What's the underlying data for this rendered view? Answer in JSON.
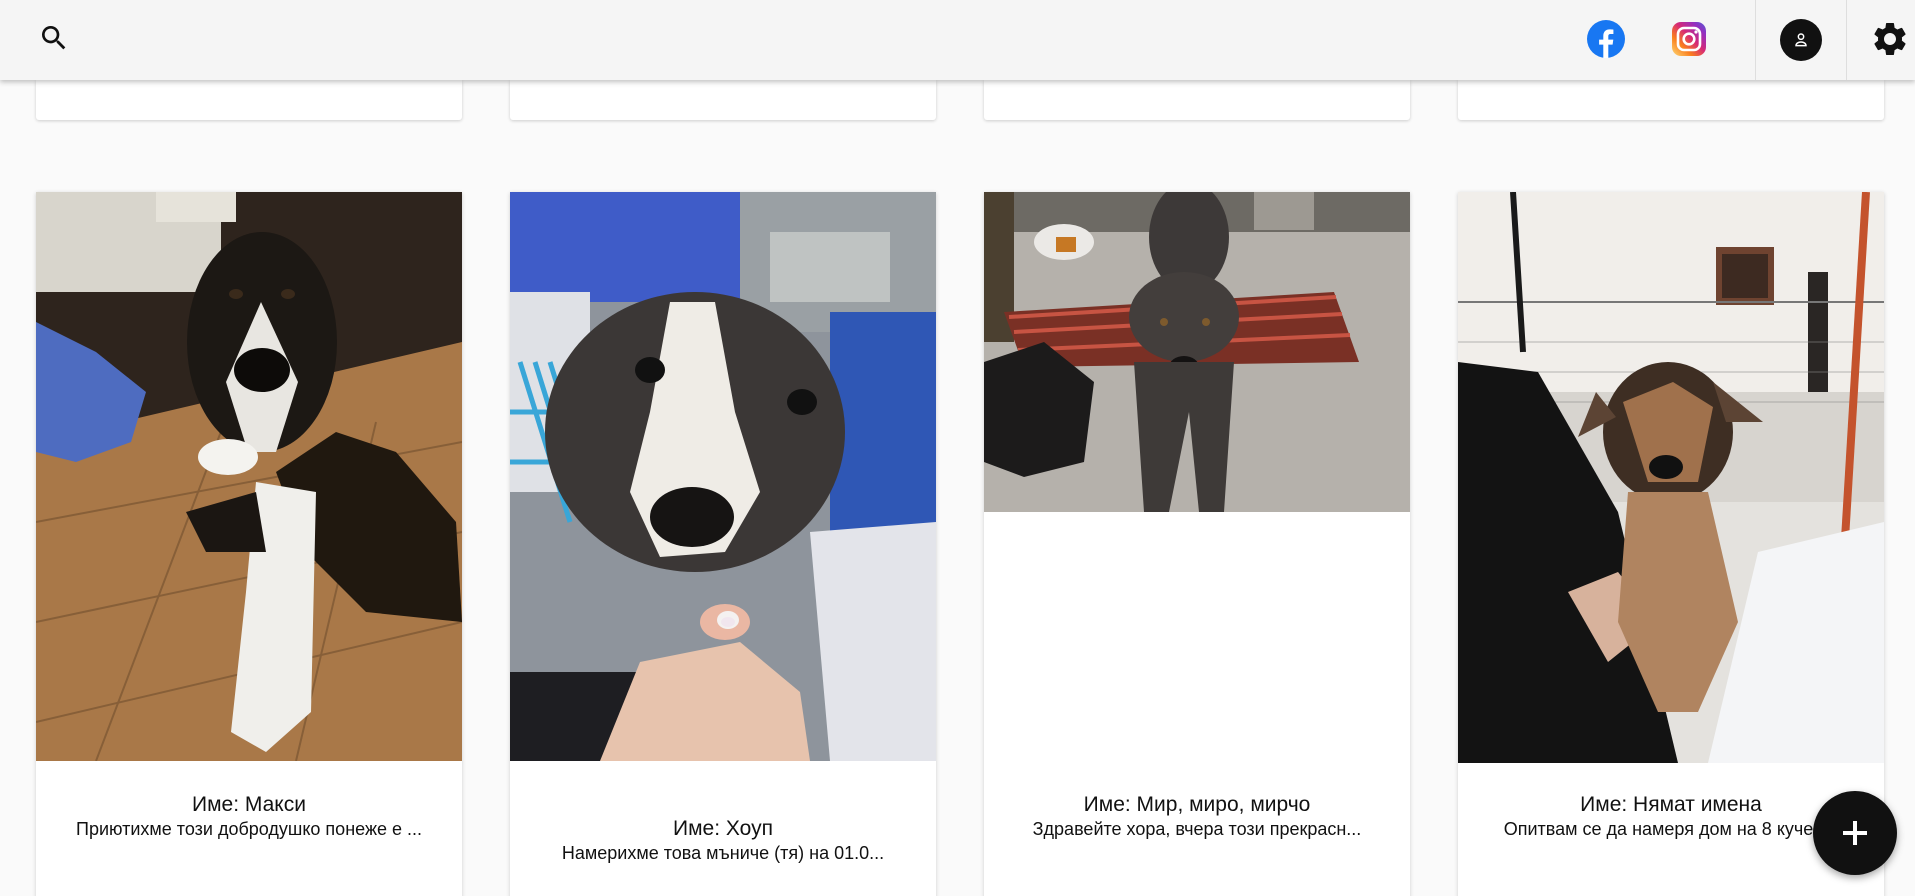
{
  "header": {
    "search_icon": "search-icon",
    "facebook_icon": "facebook-icon",
    "instagram_icon": "instagram-icon",
    "profile_icon": "person-icon",
    "settings_icon": "gear-icon"
  },
  "colors": {
    "header_bg": "#f5f5f5",
    "page_bg": "#fafafa",
    "facebook_blue": "#1877f2",
    "fab_bg": "#111111"
  },
  "cards": [
    {
      "name": "Име: Макси",
      "description": "Приютихме този добродушко понеже е ..."
    },
    {
      "name": "Име: Хоуп",
      "description": "Намерихме това мъниче (тя) на 01.0..."
    },
    {
      "name": "Име: Мир, миро, мирчо",
      "description": "Здравейте хора, вчера този прекрасн..."
    },
    {
      "name": "Име: Нямат имена",
      "description": "Опитвам се да намеря дом на 8 кучен..."
    }
  ],
  "fab": {
    "icon": "plus-icon"
  }
}
